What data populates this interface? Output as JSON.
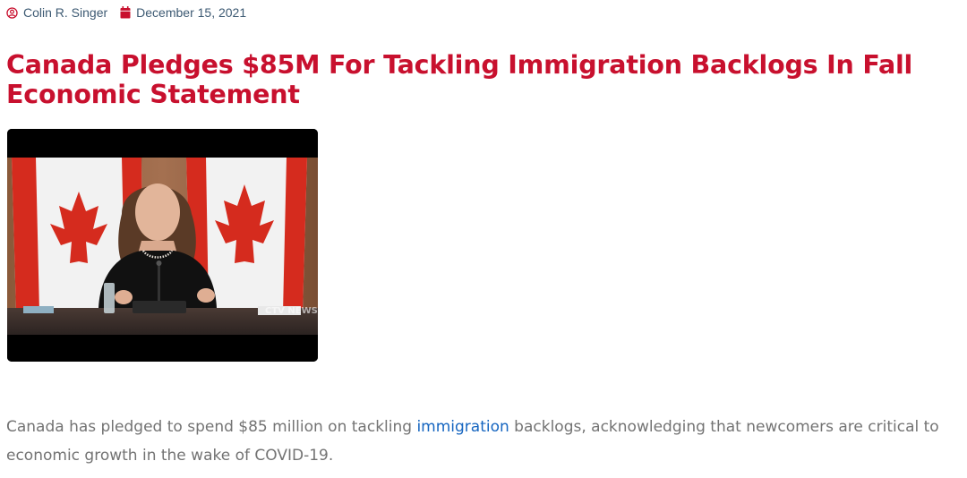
{
  "meta": {
    "author": "Colin R. Singer",
    "date": "December 15, 2021",
    "author_icon": "user-circle-icon",
    "date_icon": "calendar-icon"
  },
  "article": {
    "title": "Canada Pledges $85M For Tackling Immigration Backlogs In Fall Economic Statement",
    "body_before_link": "Canada has pledged to spend $85 million on tackling ",
    "body_link": "immigration",
    "body_after_link": " backlogs, acknowledging that newcomers are critical to economic growth in the wake of COVID-19."
  },
  "video": {
    "watermark": "CTV NEWS"
  },
  "colors": {
    "title": "#c8102e",
    "meta_icon": "#c8102e",
    "meta_text": "#3d5a73",
    "body_text": "#737373",
    "link": "#1565c0"
  }
}
